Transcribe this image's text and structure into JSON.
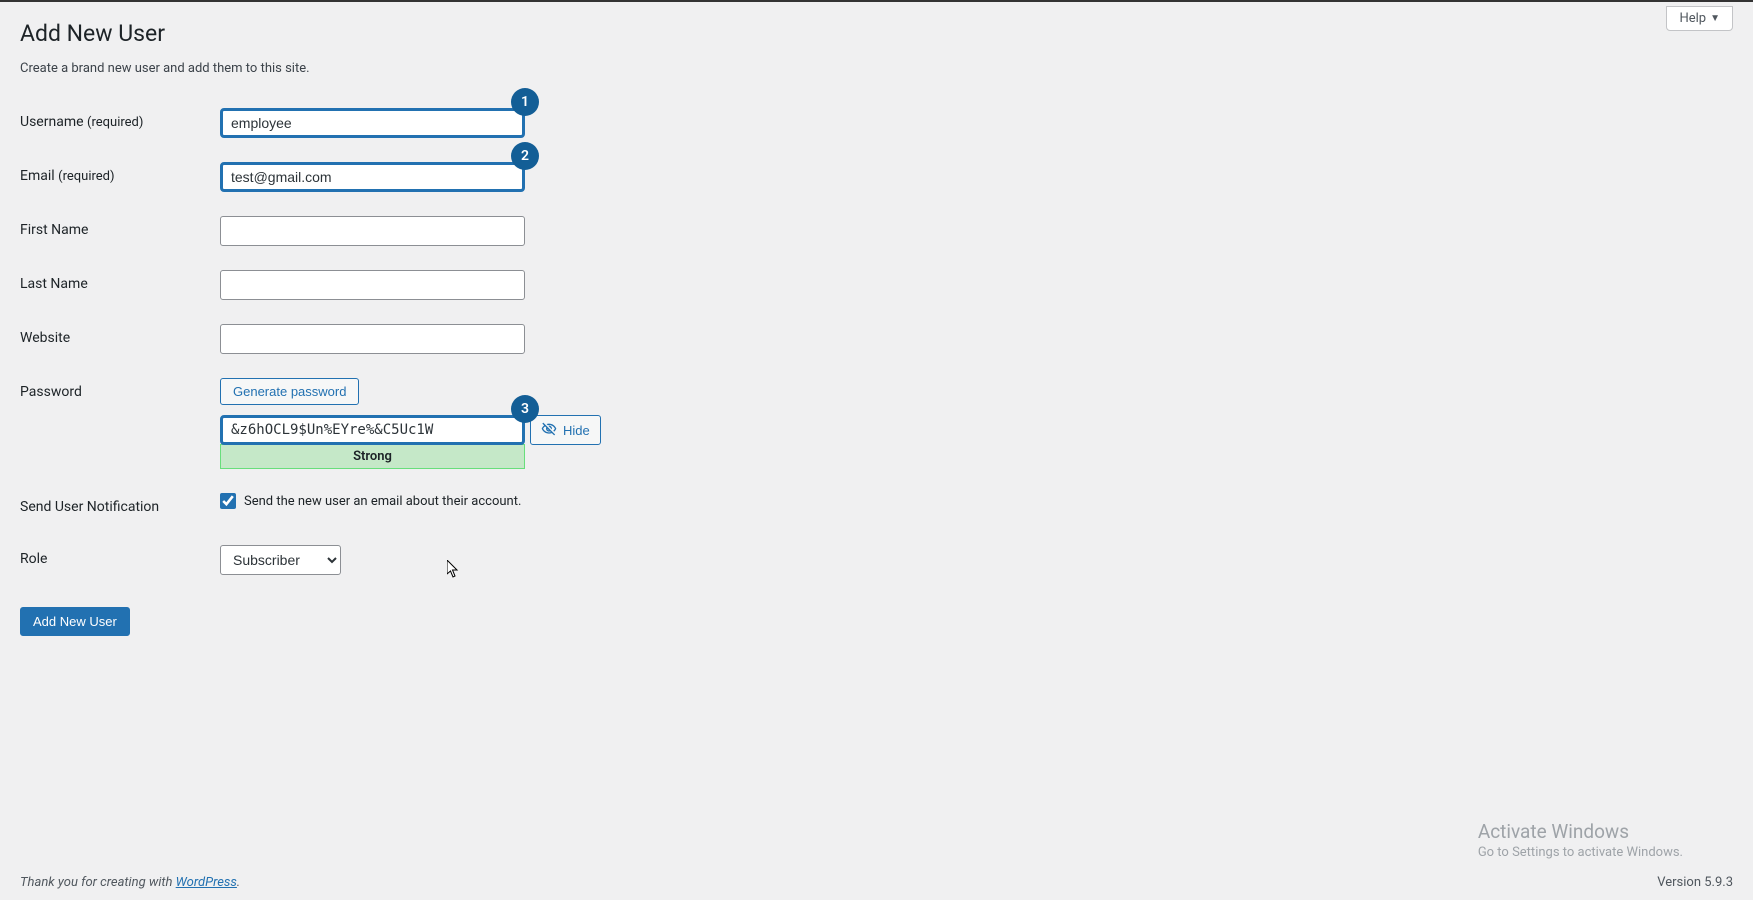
{
  "header": {
    "help_label": "Help",
    "page_title": "Add New User",
    "page_desc": "Create a brand new user and add them to this site."
  },
  "callouts": {
    "one": "1",
    "two": "2",
    "three": "3"
  },
  "form": {
    "username": {
      "label": "Username",
      "req": "(required)",
      "value": "employee"
    },
    "email": {
      "label": "Email",
      "req": "(required)",
      "value": "test@gmail.com"
    },
    "first_name": {
      "label": "First Name",
      "value": ""
    },
    "last_name": {
      "label": "Last Name",
      "value": ""
    },
    "website": {
      "label": "Website",
      "value": ""
    },
    "password": {
      "label": "Password",
      "generate_label": "Generate password",
      "value": "&z6hOCL9$Un%EYre%&C5Uc1W",
      "hide_label": "Hide",
      "strength": "Strong"
    },
    "notification": {
      "label": "Send User Notification",
      "checkbox_label": "Send the new user an email about their account.",
      "checked": true
    },
    "role": {
      "label": "Role",
      "selected": "Subscriber"
    },
    "submit_label": "Add New User"
  },
  "watermark": {
    "title": "Activate Windows",
    "sub": "Go to Settings to activate Windows."
  },
  "footer": {
    "thank_prefix": "Thank you for creating with ",
    "link_text": "WordPress",
    "thank_suffix": ".",
    "version": "Version 5.9.3"
  }
}
